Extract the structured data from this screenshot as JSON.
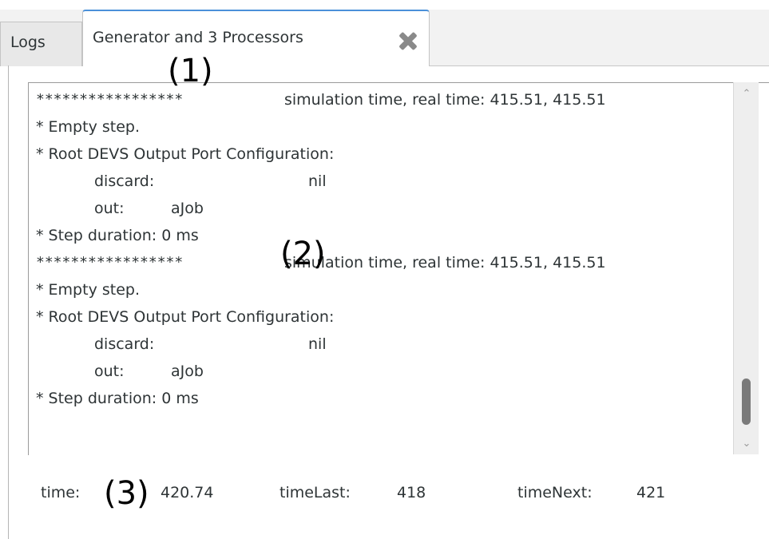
{
  "tabs": {
    "logs_label": "Logs",
    "active_label": "Generator and 3 Processors",
    "close_icon": "close-x-icon"
  },
  "annotations": {
    "a1": "(1)",
    "a2": "(2)",
    "a3": "(3)"
  },
  "log": {
    "lines": [
      {
        "stars": "*****************",
        "text": "simulation time, real time: 415.51, 415.51"
      },
      {
        "text": "* Empty step."
      },
      {
        "text": "* Root DEVS Output Port Configuration:"
      },
      {
        "port": "discard:",
        "value": "nil"
      },
      {
        "port": "out:",
        "value": "aJob"
      },
      {
        "text": "* Step duration: 0 ms"
      },
      {
        "stars": "*****************",
        "text": "simulation time, real time: 415.51, 415.51"
      },
      {
        "text": "* Empty step."
      },
      {
        "text": "* Root DEVS Output Port Configuration:"
      },
      {
        "port": "discard:",
        "value": "nil"
      },
      {
        "port": "out:",
        "value": "aJob"
      },
      {
        "text": "* Step duration: 0 ms"
      }
    ]
  },
  "status": {
    "time_label": "time:",
    "time_value": "420.74",
    "time_last_label": "timeLast:",
    "time_last_value": "418",
    "time_next_label": "timeNext:",
    "time_next_value": "421"
  },
  "scrollbar": {
    "up_icon": "chevron-up-icon",
    "down_icon": "chevron-down-icon"
  }
}
